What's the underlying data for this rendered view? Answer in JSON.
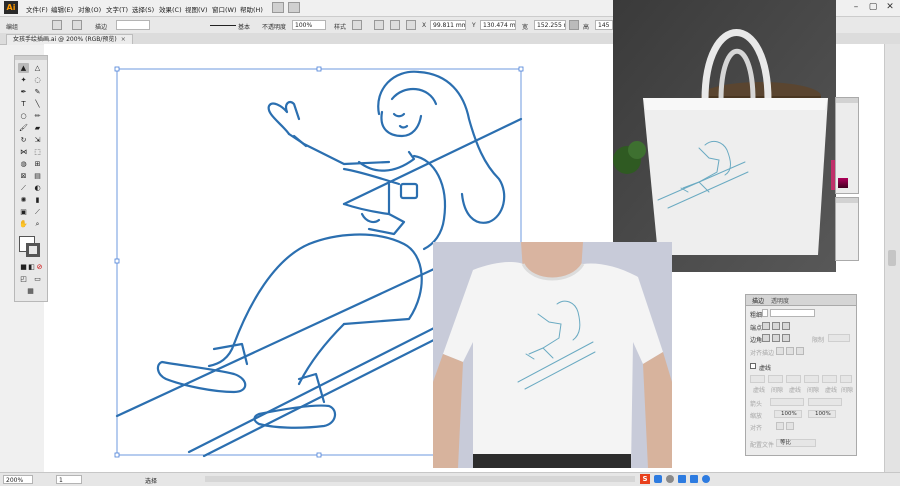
{
  "app": {
    "logo": "Ai"
  },
  "menu": [
    "文件(F)",
    "编辑(E)",
    "对象(O)",
    "文字(T)",
    "选择(S)",
    "效果(C)",
    "视图(V)",
    "窗口(W)",
    "帮助(H)"
  ],
  "window_controls": {
    "minimize": "–",
    "restore": "▢",
    "close": "✕"
  },
  "control_bar": {
    "mode_label": "编组",
    "stroke_label": "描边",
    "stroke_style": "基本",
    "opacity_label": "不透明度",
    "opacity_value": "100%",
    "style_label": "样式",
    "x_label": "X",
    "x_value": "99.811 mm",
    "y_label": "Y",
    "y_value": "130.474 mm",
    "w_label": "宽",
    "w_value": "152.255 mm",
    "h_label": "高",
    "h_value": "145"
  },
  "document_tab": {
    "name": "女孩手绘插画.ai @ 200% (RGB/预览)",
    "close": "×"
  },
  "status_bar": {
    "zoom": "200%",
    "page": "1",
    "tool_name": "选择"
  },
  "stroke_panel": {
    "tab_stroke": "描边",
    "tab_transparency": "透明度",
    "weight_label": "粗细",
    "cap_label": "端点",
    "corner_label": "边角",
    "limit_label": "限制",
    "align_label": "对齐描边",
    "dashed_label": "虚线",
    "dash_labels": [
      "虚线",
      "间隙",
      "虚线",
      "间隙",
      "虚线",
      "间隙"
    ],
    "arrow_label": "箭头",
    "scale_label": "缩放",
    "scale_value_1": "100%",
    "scale_value_2": "100%",
    "align_arrow_label": "对齐",
    "profile_label": "配置文件",
    "profile_value": "等比"
  },
  "colors": {
    "accent_stroke": "#2b6fb0",
    "selection": "#4a7fd8",
    "ui_bg": "#f0f0f0"
  }
}
